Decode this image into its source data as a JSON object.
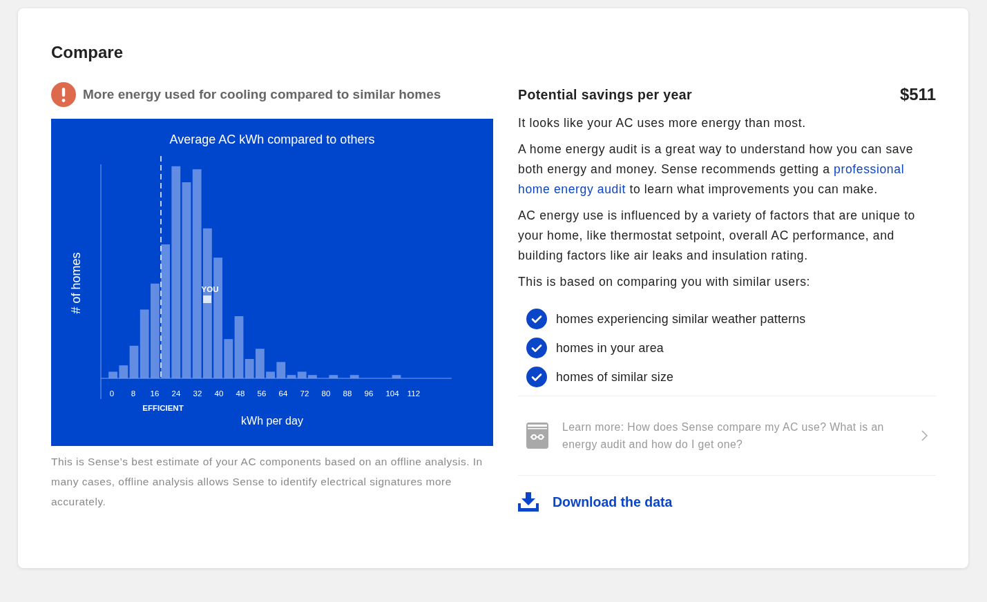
{
  "title": "Compare",
  "alert": {
    "text": "More energy used for cooling compared to similar homes"
  },
  "chart": {
    "title": "Average AC kWh compared to others",
    "ylabel": "# of homes",
    "xlabel": "kWh per day",
    "x_ticks": [
      "0",
      "8",
      "16",
      "24",
      "32",
      "40",
      "48",
      "56",
      "64",
      "72",
      "80",
      "88",
      "96",
      "104",
      "112"
    ],
    "threshold_label": "EFFICIENT",
    "marker_label": "YOU"
  },
  "caption": "This is Sense’s best estimate of your AC components based on an offline analysis. In many cases, offline analysis allows Sense to identify electrical signatures more accurately.",
  "savings": {
    "label": "Potential savings per year",
    "amount": "$511"
  },
  "paragraphs": [
    [
      {
        "kind": "text",
        "text": "It looks like your AC uses more energy than most."
      }
    ],
    [
      {
        "kind": "text",
        "text": "A home energy audit is a great way to understand how you can save both energy and money. Sense recommends getting a "
      },
      {
        "kind": "link",
        "text": "professional "
      },
      {
        "kind": "link",
        "text": "home energy audit"
      },
      {
        "kind": "text",
        "text": " to learn what improvements you can make."
      }
    ],
    [
      {
        "kind": "text",
        "text": "AC energy use is influenced by a variety of factors that are unique to your home, like thermostat setpoint, overall AC performance, and building factors like air leaks and insulation rating."
      }
    ],
    [
      {
        "kind": "text",
        "text": "This is based on comparing you with similar users:"
      }
    ]
  ],
  "criteria": [
    {
      "text": "homes experiencing similar weather patterns",
      "checked": true
    },
    {
      "text": "homes in your area",
      "checked": true
    },
    {
      "text": "homes of similar size",
      "checked": true
    }
  ],
  "learn_more": {
    "text": "Learn more: How does Sense compare my AC use? What is an energy audit and how do I get one?"
  },
  "download": {
    "label": "Download the data"
  }
}
